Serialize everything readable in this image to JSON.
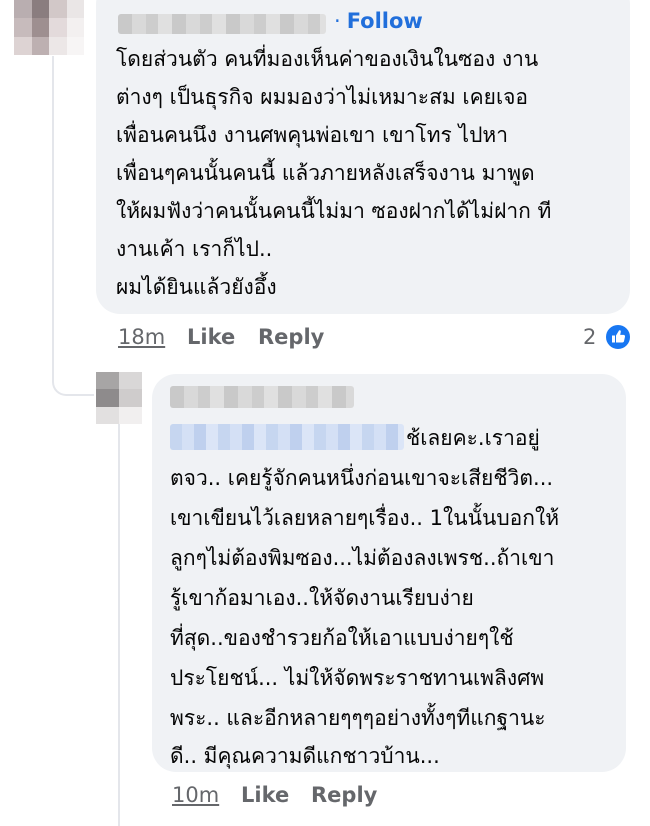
{
  "comments": [
    {
      "follow_label": "Follow",
      "lines": [
        "โดยส่วนตัว คนที่มองเห็นค่าของเงินในซอง งาน",
        "ต่างๆ เป็นธุรกิจ ผมมองว่าไม่เหมาะสม เคยเจอ",
        "เพื่อนคนนึง งานศพคุนพ่อเขา เขาโทร ไปหา",
        "เพื่อนๆคนนั้นคนนี้ แล้วภายหลังเสร็จงาน มาพูด",
        "ให้ผมฟังว่าคนนั้นคนนี้ไม่มา ซองฝากได้ไม่ฝาก ที",
        "งานเค้า เราก็ไป..",
        "ผมได้ยินแล้วยังอึ้ง"
      ],
      "time": "18m",
      "like_label": "Like",
      "reply_label": "Reply",
      "reaction_count": "2",
      "reaction_icon": "thumbs-up-icon",
      "accent_color": "#1877f2"
    },
    {
      "first_line_suffix": "ช้เลยคะ.เราอยู่",
      "lines": [
        "ตจว.. เคยรู้จักคนหนึ่งก่อนเขาจะเสียชีวิต...",
        "เขาเขียนไว้เลยหลายๆเรื่อง.. 1ในนั้นบอกให้",
        "ลูกๆไม่ต้องพิมซอง...ไม่ต้องลงเพรช..ถ้าเขา",
        "รู้เขาก้อมาเอง..ให้จัดงานเรียบง่าย",
        "ที่สุด..ของชำรวยก้อให้เอาแบบง่ายๆใช้",
        "ประโยชน์... ไม่ให้จัดพระราชทานเพลิงศพ",
        "พระ.. และอีกหลายๆๆๆอย่างทั้งๆทีแกฐานะ",
        "ดี.. มีคุณความดีแกชาวบ้าน..."
      ],
      "time": "10m",
      "like_label": "Like",
      "reply_label": "Reply"
    }
  ]
}
